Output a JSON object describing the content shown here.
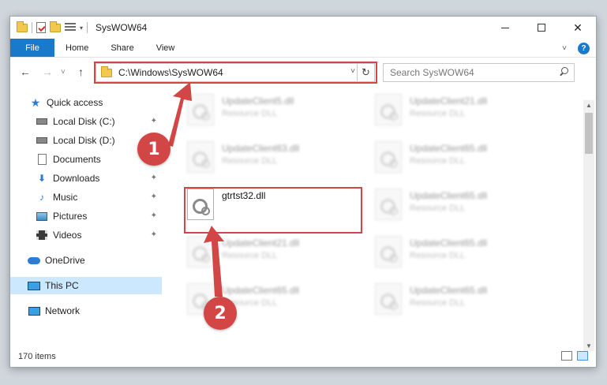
{
  "window": {
    "title": "SysWOW64",
    "maximize_glyph": "☐",
    "close_glyph": "✕"
  },
  "ribbon": {
    "tabs": [
      {
        "label": "File"
      },
      {
        "label": "Home"
      },
      {
        "label": "Share"
      },
      {
        "label": "View"
      }
    ],
    "expand_glyph": "˅",
    "help_glyph": "?"
  },
  "nav": {
    "back": "←",
    "forward": "→",
    "history": "˅",
    "up": "↑"
  },
  "address": {
    "path": "C:\\Windows\\SysWOW64",
    "dropdown": "˅",
    "refresh": "↻"
  },
  "search": {
    "placeholder": "Search SysWOW64"
  },
  "sidebar": {
    "quick_access": "Quick access",
    "items": [
      {
        "label": "Local Disk (C:)",
        "pinned": true
      },
      {
        "label": "Local Disk (D:)",
        "pinned": false
      },
      {
        "label": "Documents",
        "pinned": true
      },
      {
        "label": "Downloads",
        "pinned": true
      },
      {
        "label": "Music",
        "pinned": true
      },
      {
        "label": "Pictures",
        "pinned": true
      },
      {
        "label": "Videos",
        "pinned": true
      }
    ],
    "onedrive": "OneDrive",
    "this_pc": "This PC",
    "network": "Network",
    "pin_glyph": "📌"
  },
  "files": {
    "main": {
      "name": "gtrtst32.dll"
    },
    "background": [
      {
        "name": "UpdateClient5.dll",
        "desc": "Resource DLL"
      },
      {
        "name": "UpdateClient21.dll",
        "desc": "Resource DLL"
      },
      {
        "name": "UpdateClient63.dll",
        "desc": "Resource DLL"
      },
      {
        "name": "UpdateClient65.dll",
        "desc": "Resource DLL"
      },
      {
        "name": "UpdateClient65.dll",
        "desc": "Resource DLL"
      },
      {
        "name": "UpdateClient21.dll",
        "desc": "Resource DLL"
      },
      {
        "name": "UpdateClient65.dll",
        "desc": "Resource DLL"
      },
      {
        "name": "UpdateClient65.dll",
        "desc": "Resource DLL"
      },
      {
        "name": "UpdateClient65.dll",
        "desc": "Resource DLL"
      }
    ]
  },
  "status": {
    "item_count": "170 items"
  },
  "callouts": {
    "one": "1",
    "two": "2"
  },
  "colors": {
    "accent": "#1979ca",
    "highlight": "#d24646",
    "selected_nav": "#cce8ff"
  }
}
